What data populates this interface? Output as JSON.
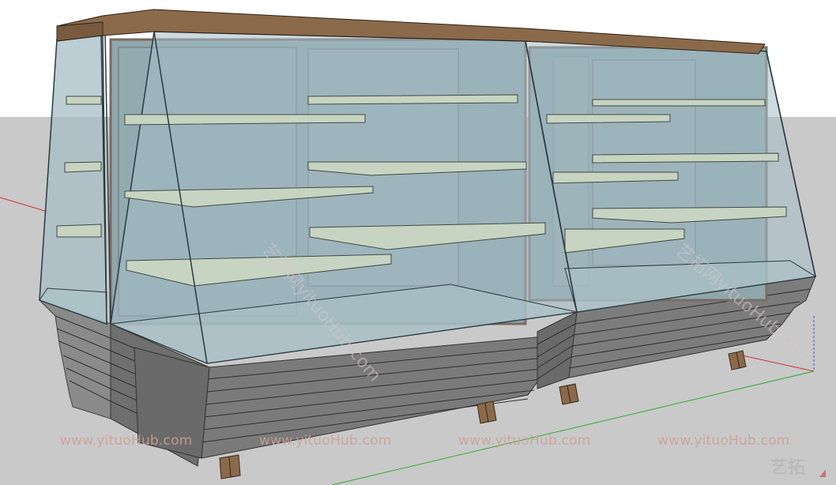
{
  "watermarks": {
    "bottom_row": [
      "www.yituoHub.com",
      "www.yituoHub.com",
      "www.yituoHub.com",
      "www.yituoHub.com"
    ],
    "diagonal_left": "艺拓网yituoHub.com",
    "diagonal_right": "艺拓网yituoHub.com",
    "logo": "艺拓"
  },
  "colors": {
    "sky": "#ffffff",
    "ground": "#c8c8c8",
    "glass": "#9fb8c0",
    "wood_top": "#8b6a4c",
    "frame": "#7d6f6a",
    "base": "#7a7a7a",
    "shelf": "#c7d3c0",
    "axis_red": "#cc2222",
    "axis_green": "#22aa22"
  }
}
